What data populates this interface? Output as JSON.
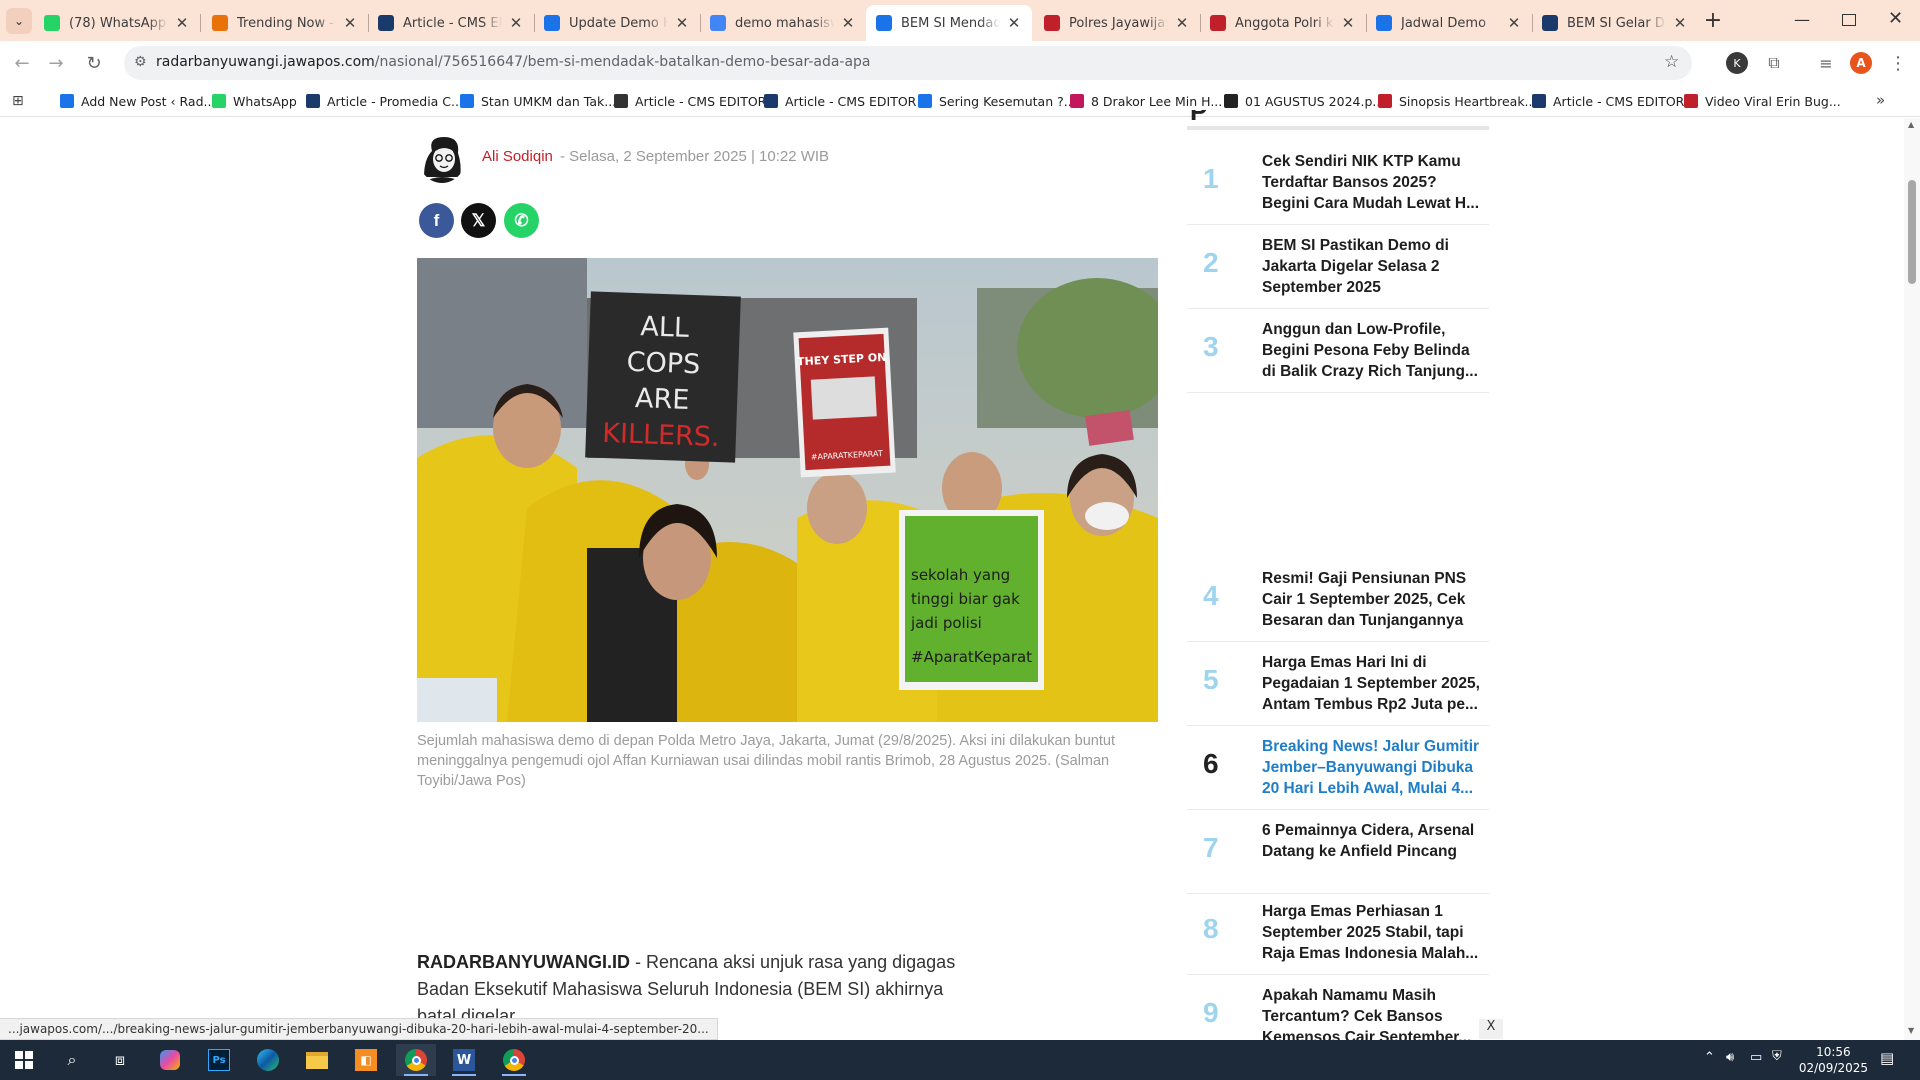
{
  "browser": {
    "tabs": [
      {
        "label": "(78) WhatsApp",
        "icon": "whatsapp-icon",
        "color": "#25d366"
      },
      {
        "label": "Trending Now - G",
        "icon": "trending-icon",
        "color": "#e8710a"
      },
      {
        "label": "Article - CMS EDIT",
        "icon": "promedia-icon",
        "color": "#1a3a6b"
      },
      {
        "label": "Update Demo Har",
        "icon": "doc-icon",
        "color": "#1a73e8"
      },
      {
        "label": "demo mahasiswa",
        "icon": "google-icon",
        "color": "#4285f4"
      },
      {
        "label": "BEM SI Mendadak",
        "icon": "radar-icon",
        "color": "#1a73e8"
      },
      {
        "label": "Polres Jayawijaya",
        "icon": "news-icon",
        "color": "#c0202a"
      },
      {
        "label": "Anggota Polri kor",
        "icon": "news-icon",
        "color": "#c0202a"
      },
      {
        "label": "Jadwal Demo",
        "icon": "search-icon",
        "color": "#1a73e8"
      },
      {
        "label": "BEM SI Gelar Dem",
        "icon": "news-icon",
        "color": "#1a3a6b"
      }
    ],
    "url_host": "radarbanyuwangi.jawapos.com",
    "url_path": "/nasional/756516647/bem-si-mendadak-batalkan-demo-besar-ada-apa",
    "profile_initial": "A",
    "ext_initial": "K",
    "bookmarks": [
      {
        "label": "Add New Post ‹ Rad...",
        "color": "#1a73e8"
      },
      {
        "label": "WhatsApp",
        "color": "#25d366"
      },
      {
        "label": "Article - Promedia C...",
        "color": "#1a3a6b"
      },
      {
        "label": "Stan UMKM dan Tak...",
        "color": "#1a73e8"
      },
      {
        "label": "Article - CMS EDITOR",
        "color": "#333333"
      },
      {
        "label": "Article - CMS EDITOR",
        "color": "#1a3a6b"
      },
      {
        "label": "Sering Kesemutan ?...",
        "color": "#1a73e8"
      },
      {
        "label": "8 Drakor Lee Min H...",
        "color": "#c2185b"
      },
      {
        "label": "01 AGUSTUS 2024.p...",
        "color": "#222222"
      },
      {
        "label": "Sinopsis Heartbreak...",
        "color": "#c0202a"
      },
      {
        "label": "Article - CMS EDITOR",
        "color": "#1a3a6b"
      },
      {
        "label": "Video Viral Erin Bug...",
        "color": "#c0202a"
      }
    ]
  },
  "article": {
    "author": "Ali Sodiqin",
    "date": "- Selasa, 2 September 2025 | 10:22 WIB",
    "photo_signs": {
      "sign1": [
        "ALL",
        "COPS",
        "ARE",
        "KILLERS."
      ],
      "sign2_top": "THEY STEP ON",
      "sign2_bottom": "#APARATKEPARAT",
      "sign3": [
        "sekolah   yang",
        "tinggi biar gak",
        "jadi     polisi",
        "#AparatKeparat"
      ]
    },
    "caption": "Sejumlah mahasiswa demo di depan Polda Metro Jaya, Jakarta, Jumat (29/8/2025). Aksi ini dilakukan buntut meninggalnya pengemudi ojol Affan Kurniawan usai dilindas mobil rantis Brimob, 28 Agustus 2025. (Salman Toyibi/Jawa Pos)",
    "lead_source": "RADARBANYUWANGI.ID",
    "lead_text": " - Rencana aksi unjuk rasa yang digagas Badan Eksekutif Mahasiswa Seluruh Indonesia (BEM SI) akhirnya batal digelar."
  },
  "popular": [
    {
      "num": "1",
      "title": "Cek Sendiri NIK KTP Kamu Terdaftar Bansos 2025? Begini Cara Mudah Lewat H..."
    },
    {
      "num": "2",
      "title": "BEM SI Pastikan Demo di Jakarta Digelar Selasa 2 September 2025"
    },
    {
      "num": "3",
      "title": "Anggun dan Low-Profile, Begini Pesona Feby Belinda di Balik Crazy Rich Tanjung..."
    },
    {
      "num": "4",
      "title": "Resmi! Gaji Pensiunan PNS Cair 1 September 2025, Cek Besaran dan Tunjangannya"
    },
    {
      "num": "5",
      "title": "Harga Emas Hari Ini di Pegadaian 1 September 2025, Antam Tembus Rp2 Juta pe..."
    },
    {
      "num": "6",
      "title": "Breaking News! Jalur Gumitir Jember–Banyuwangi Dibuka 20 Hari Lebih Awal, Mulai 4..."
    },
    {
      "num": "7",
      "title": "6 Pemainnya Cidera, Arsenal Datang ke Anfield Pincang"
    },
    {
      "num": "8",
      "title": "Harga Emas Perhiasan 1 September 2025 Stabil, tapi Raja Emas Indonesia Malah..."
    },
    {
      "num": "9",
      "title": "Apakah Namamu Masih Tercantum? Cek Bansos Kemensos Cair September..."
    }
  ],
  "ad_close": "X",
  "status_url": "...jawapos.com/.../breaking-news-jalur-gumitir-jemberbanyuwangi-dibuka-20-hari-lebih-awal-mulai-4-september-20...",
  "taskbar": {
    "time": "10:56",
    "date": "02/09/2025"
  },
  "colors": {
    "tabstrip": "#fbe3d6",
    "author": "#c0202a",
    "popular_num": "#9fd4ee",
    "highlight": "#1f7ec5",
    "taskbar": "#1c2a3a"
  }
}
